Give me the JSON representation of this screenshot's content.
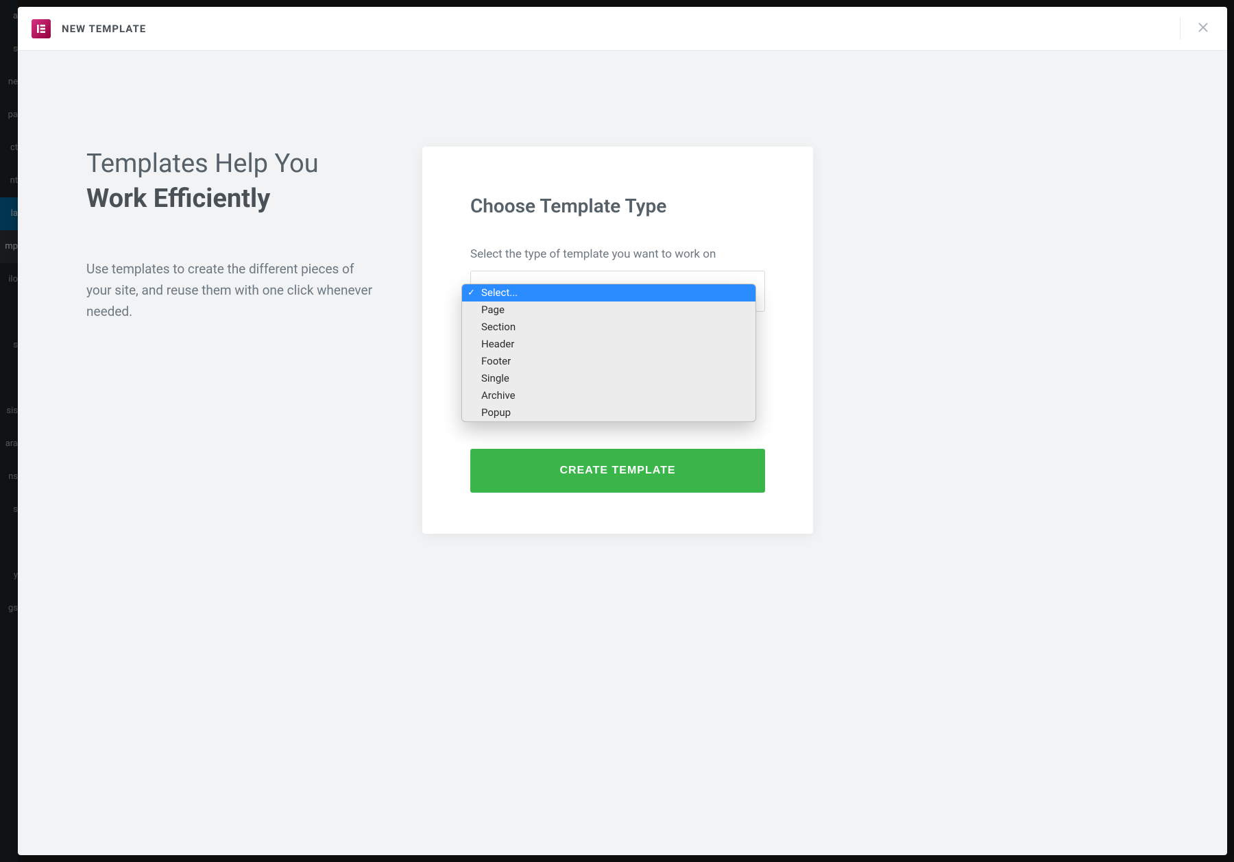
{
  "sidebar": {
    "items": [
      "a",
      "s",
      "ne",
      "pa",
      "ct",
      "nt",
      "la",
      "mp",
      "ilo",
      "",
      "s",
      "",
      "sis",
      "ara",
      "ns",
      "s",
      "",
      "y",
      "gs"
    ],
    "active_index": 6,
    "sub_active_index": 7
  },
  "modal": {
    "brand_icon": "elementor-icon",
    "title": "NEW TEMPLATE",
    "close_label": "Close"
  },
  "promo": {
    "heading_line1": "Templates Help You",
    "heading_line2": "Work Efficiently",
    "body": "Use templates to create the different pieces of your site, and reuse them with one click whenever needed."
  },
  "form": {
    "title": "Choose Template Type",
    "type_label": "Select the type of template you want to work on",
    "type_placeholder": "Select...",
    "type_options": [
      "Select...",
      "Page",
      "Section",
      "Header",
      "Footer",
      "Single",
      "Archive",
      "Popup"
    ],
    "type_selected_index": 0,
    "submit_label": "CREATE TEMPLATE"
  },
  "colors": {
    "accent_green": "#39b54a",
    "accent_blue": "#2b8cff",
    "brand_gradient_from": "#d63384",
    "brand_gradient_to": "#93003a"
  }
}
